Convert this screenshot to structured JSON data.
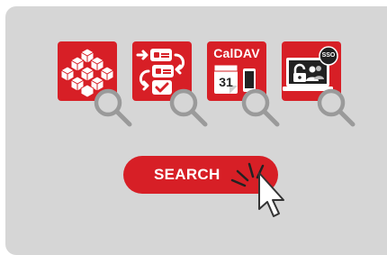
{
  "tiles": [
    {
      "icon": "blockchain-network-icon"
    },
    {
      "icon": "checklist-sync-icon"
    },
    {
      "icon": "caldav-calendar-icon",
      "label": "CalDAV",
      "day": "31"
    },
    {
      "icon": "sso-laptop-icon",
      "badge": "SSO"
    }
  ],
  "button": {
    "label": "SEARCH"
  },
  "colors": {
    "accent": "#d71f26",
    "background": "#d6d6d6",
    "magnifier": "#9a9a9a"
  }
}
